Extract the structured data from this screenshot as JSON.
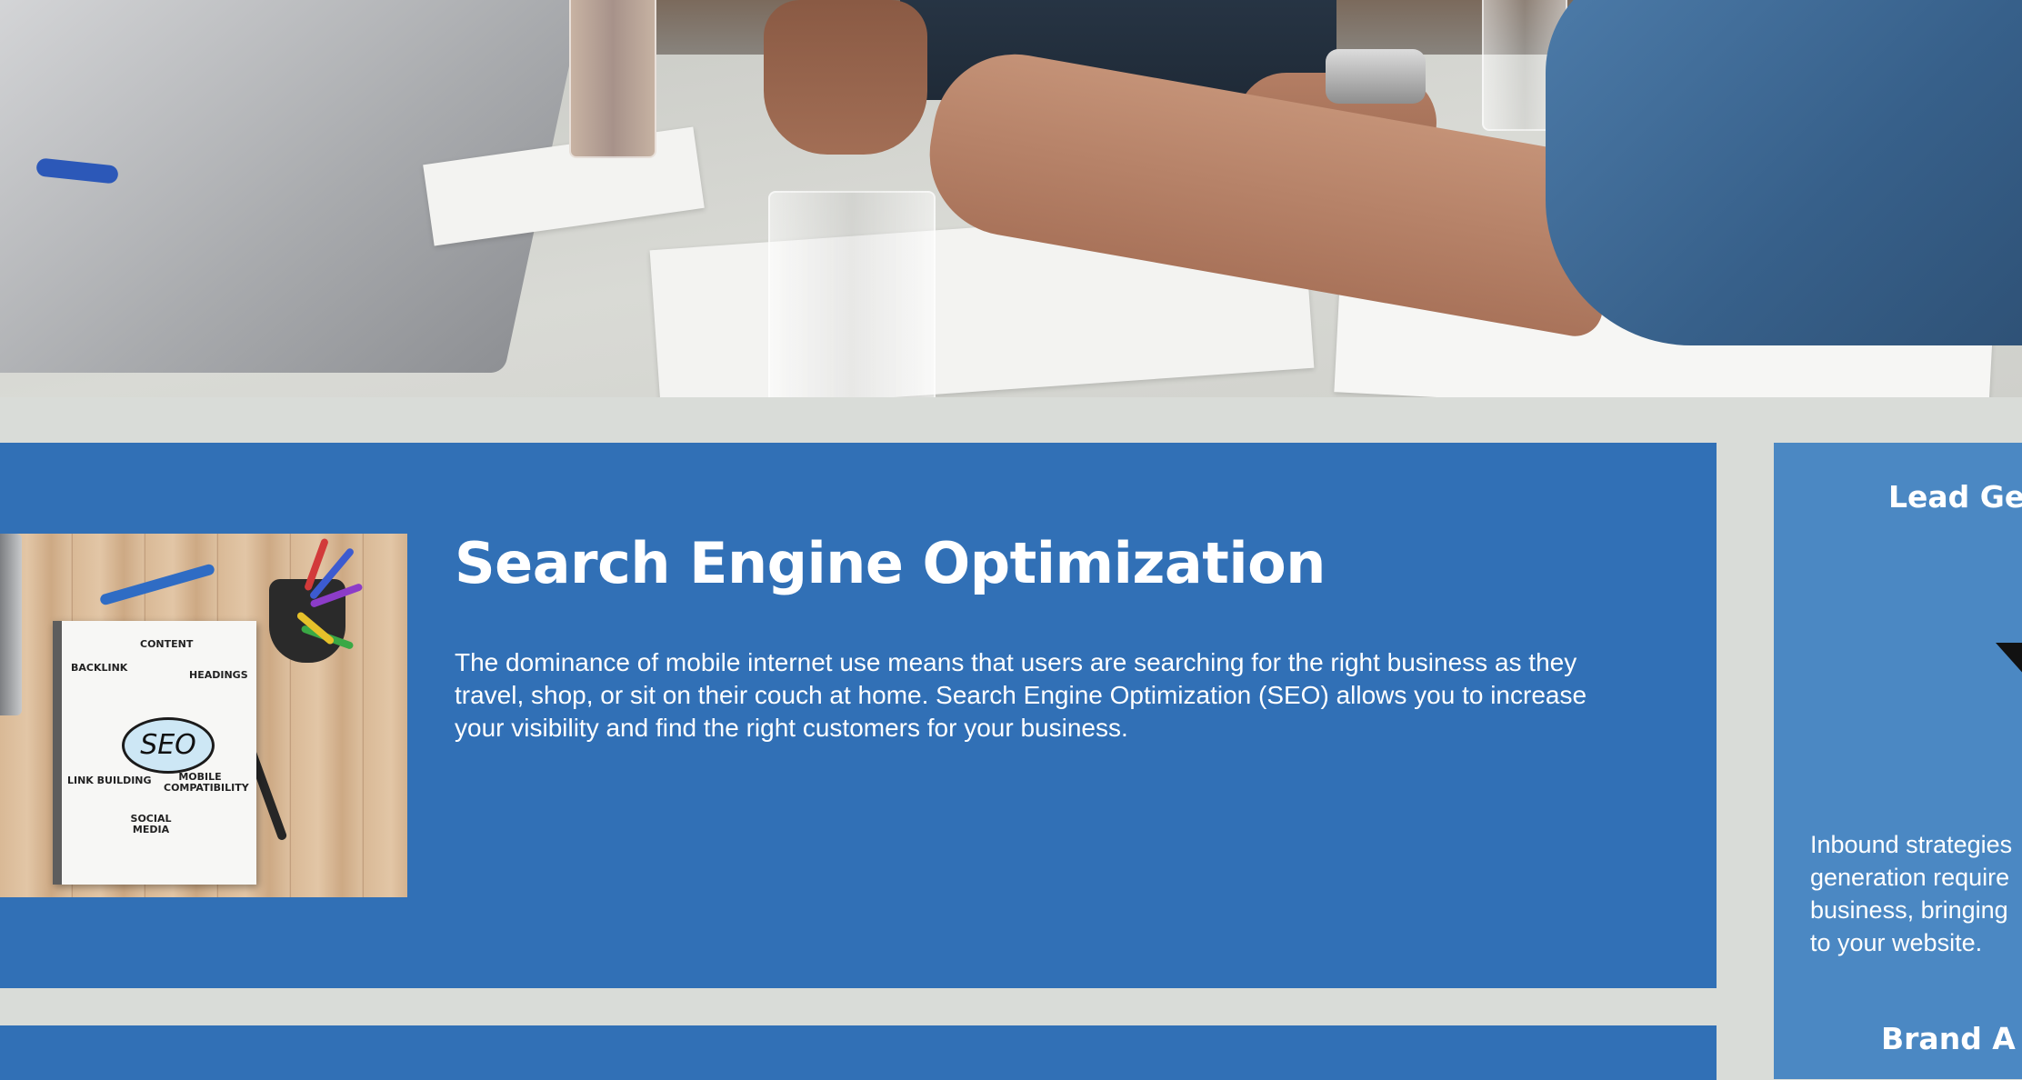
{
  "hero": {
    "image_alt": "Team collaborating over documents at a meeting table"
  },
  "seo_card": {
    "title": "Search Engine Optimization",
    "body": "The dominance of mobile internet use means that users are searching for the right business as they travel, shop, or sit on their couch at home. Search Engine Optimization (SEO) allows you to increase your visibility and find the right customers for your business.",
    "image_labels": {
      "center": "SEO",
      "content": "CONTENT",
      "backlink": "BACKLINK",
      "headings": "HEADINGS",
      "link_building": "LINK BUILDING",
      "mobile": "MOBILE COMPATIBILITY",
      "social": "SOCIAL MEDIA"
    }
  },
  "side_card": {
    "title": "Lead Ge",
    "icon": "gear-funnel-icon",
    "body_lines": [
      "Inbound strategies",
      "generation require",
      "business, bringing",
      "to your website."
    ],
    "next_title": "Brand A"
  },
  "colors": {
    "page_background": "#d9dcd8",
    "main_panel": "#3170b6",
    "side_panel": "#4b88c3",
    "text": "#ffffff"
  }
}
